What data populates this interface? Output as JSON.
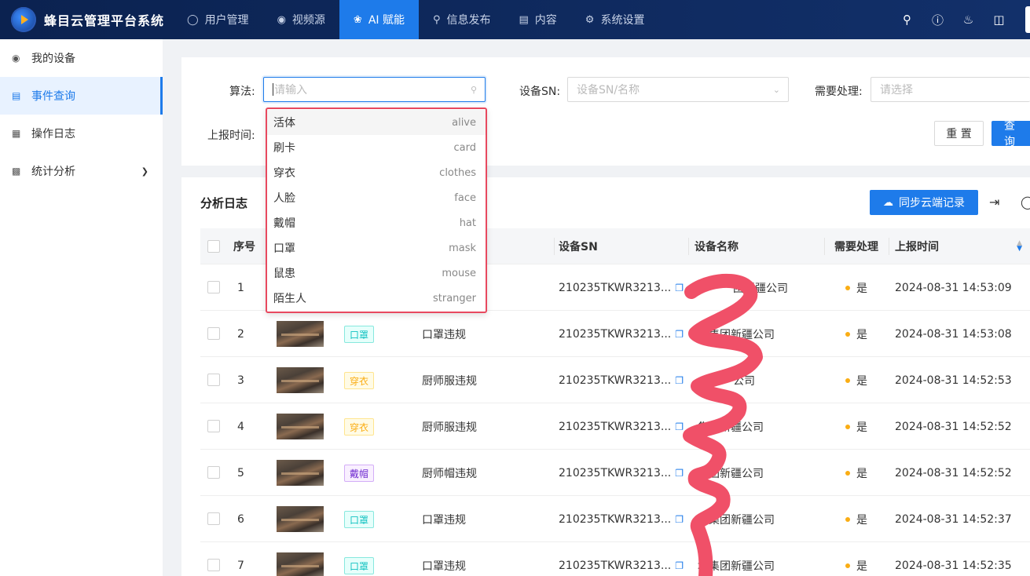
{
  "app": {
    "title": "蜂目云管理平台系统"
  },
  "nav": [
    {
      "label": "用户管理",
      "icon": "user-icon",
      "active": false
    },
    {
      "label": "视频源",
      "icon": "eye-icon",
      "active": false
    },
    {
      "label": "AI 赋能",
      "icon": "ai-icon",
      "active": true
    },
    {
      "label": "信息发布",
      "icon": "broadcast-icon",
      "active": false
    },
    {
      "label": "内容",
      "icon": "book-icon",
      "active": false
    },
    {
      "label": "系统设置",
      "icon": "gear-icon",
      "active": false
    }
  ],
  "sidebar": {
    "items": [
      {
        "label": "我的设备",
        "icon": "camera-icon"
      },
      {
        "label": "事件查询",
        "icon": "id-card-icon",
        "active": true
      },
      {
        "label": "操作日志",
        "icon": "calendar-icon"
      },
      {
        "label": "统计分析",
        "icon": "bar-chart-icon"
      }
    ]
  },
  "filter": {
    "algo_label": "算法:",
    "algo_placeholder": "请输入",
    "sn_label": "设备SN:",
    "sn_placeholder": "设备SN/名称",
    "need_label": "需要处理:",
    "need_placeholder": "请选择",
    "time_label": "上报时间:",
    "reset": "重 置",
    "query": "查 询"
  },
  "dropdown": [
    {
      "cn": "活体",
      "en": "alive"
    },
    {
      "cn": "刷卡",
      "en": "card"
    },
    {
      "cn": "穿衣",
      "en": "clothes"
    },
    {
      "cn": "人脸",
      "en": "face"
    },
    {
      "cn": "戴帽",
      "en": "hat"
    },
    {
      "cn": "口罩",
      "en": "mask"
    },
    {
      "cn": "鼠患",
      "en": "mouse"
    },
    {
      "cn": "陌生人",
      "en": "stranger"
    }
  ],
  "list": {
    "title": "分析日志",
    "sync_button": "同步云端记录",
    "columns": {
      "index": "序号",
      "sn": "设备SN",
      "name": "设备名称",
      "need": "需要处理",
      "time": "上报时间"
    },
    "rows": [
      {
        "index": "1",
        "tag": "",
        "event": "",
        "sn": "210235TKWR3213...",
        "name": "团新疆公司",
        "need": "是",
        "time": "2024-08-31 14:53:09"
      },
      {
        "index": "2",
        "tag": "口罩",
        "event": "口罩违规",
        "sn": "210235TKWR3213...",
        "name": "地集团新疆公司",
        "need": "是",
        "time": "2024-08-31 14:53:08"
      },
      {
        "index": "3",
        "tag": "穿衣",
        "event": "厨师服违规",
        "sn": "210235TKWR3213...",
        "name": "公司",
        "need": "是",
        "time": "2024-08-31 14:52:53"
      },
      {
        "index": "4",
        "tag": "穿衣",
        "event": "厨师服违规",
        "sn": "210235TKWR3213...",
        "name": "集团新疆公司",
        "need": "是",
        "time": "2024-08-31 14:52:52"
      },
      {
        "index": "5",
        "tag": "戴帽",
        "event": "厨师帽违规",
        "sn": "210235TKWR3213...",
        "name": "集团新疆公司",
        "need": "是",
        "time": "2024-08-31 14:52:52"
      },
      {
        "index": "6",
        "tag": "口罩",
        "event": "口罩违规",
        "sn": "210235TKWR3213...",
        "name": "地集团新疆公司",
        "need": "是",
        "time": "2024-08-31 14:52:37"
      },
      {
        "index": "7",
        "tag": "口罩",
        "event": "口罩违规",
        "sn": "210235TKWR3213...",
        "name": "地集团新疆公司",
        "need": "是",
        "time": "2024-08-31 14:52:35"
      }
    ]
  },
  "colors": {
    "accent": "#1e7bea",
    "topbar": "#0b2250",
    "tag_mask": "#13c2c2",
    "tag_clothes": "#faad14",
    "tag_hat": "#722ed1",
    "need_dot": "#faad14",
    "scribble": "#f05068",
    "highlight_border": "#e8495f"
  }
}
